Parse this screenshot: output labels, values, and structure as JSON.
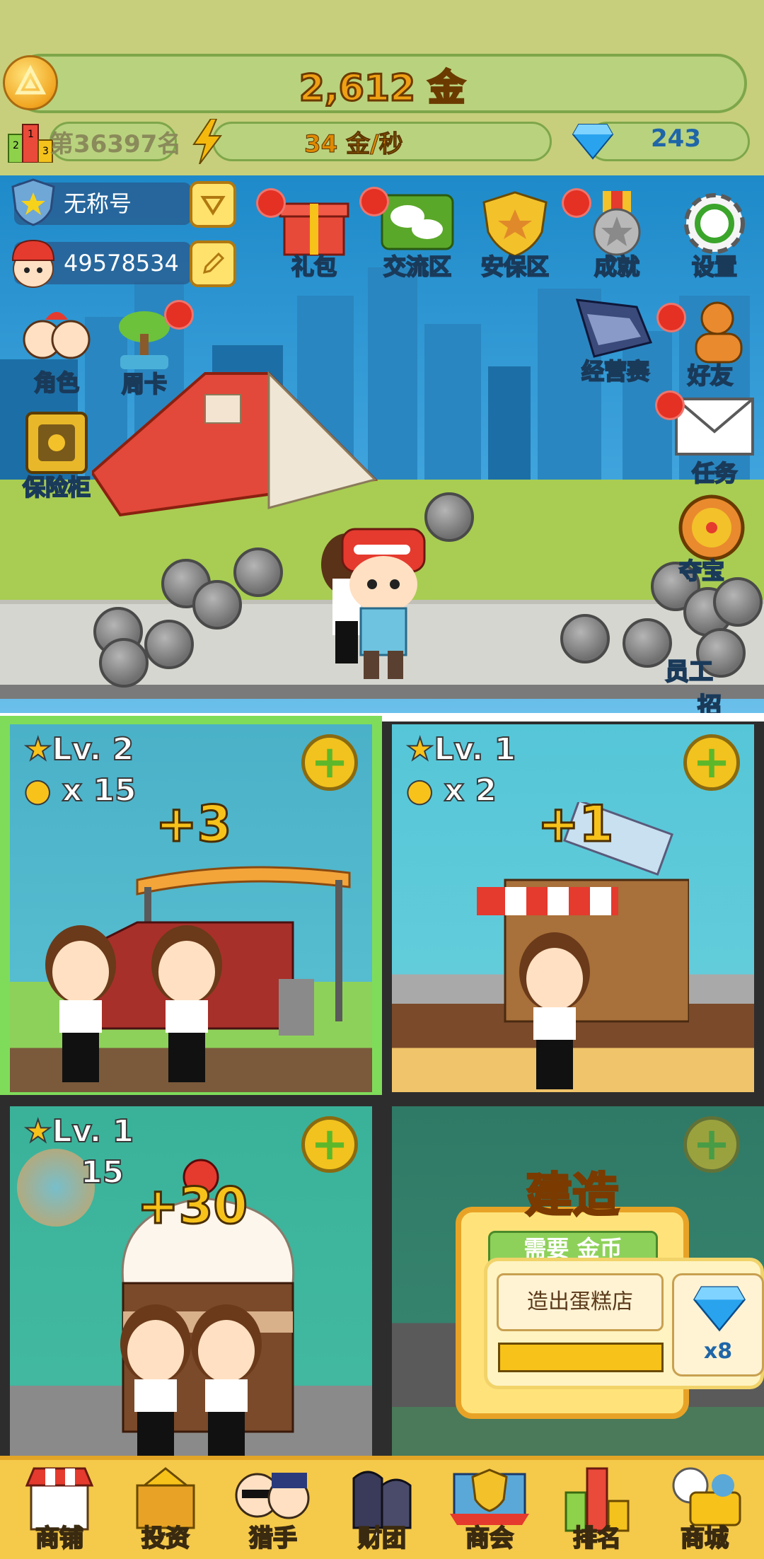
{
  "hud": {
    "gold": "2,612 金",
    "rank": "第36397名",
    "speed": "34 金/秒",
    "diamonds": "243"
  },
  "player": {
    "title": "无称号",
    "id": "49578534"
  },
  "top_menu": [
    {
      "label": "礼包",
      "icon": "gift-icon",
      "badge": true
    },
    {
      "label": "交流区",
      "icon": "chat-icon",
      "badge": true
    },
    {
      "label": "安保区",
      "icon": "shield-icon",
      "badge": false
    },
    {
      "label": "成就",
      "icon": "medal-icon",
      "badge": true
    },
    {
      "label": "设置",
      "icon": "gear-icon",
      "badge": false
    }
  ],
  "left_menu": [
    {
      "label": "角色",
      "icon": "characters-icon"
    },
    {
      "label": "周卡",
      "icon": "bonsai-icon",
      "badge": true
    },
    {
      "label": "保险柜",
      "icon": "safe-icon"
    }
  ],
  "right_menu": [
    {
      "label": "经营赛",
      "icon": "contest-icon"
    },
    {
      "label": "好友",
      "icon": "friends-icon",
      "badge": true
    },
    {
      "label": "任务",
      "icon": "envelope-icon",
      "badge": true
    },
    {
      "label": "夺宝",
      "icon": "wheel-icon"
    },
    {
      "label": "员工",
      "icon": "staff-icon"
    },
    {
      "label": "招",
      "icon": ""
    }
  ],
  "shops": [
    {
      "level": "Lv. 2",
      "staff": "x 15",
      "income": "+3"
    },
    {
      "level": "Lv. 1",
      "staff": "x 2",
      "income": "+1"
    },
    {
      "level": "Lv. 1",
      "staff": "15",
      "income": "+30"
    },
    {
      "build_title": "建造",
      "build_sub": "需要 金币",
      "tooltip": "造出蛋糕店",
      "cost": "x8"
    }
  ],
  "nav": [
    {
      "label": "商铺",
      "icon": "shop-icon"
    },
    {
      "label": "投资",
      "icon": "invest-icon"
    },
    {
      "label": "猎手",
      "icon": "hunter-icon"
    },
    {
      "label": "财团",
      "icon": "consortium-icon"
    },
    {
      "label": "商会",
      "icon": "guild-icon"
    },
    {
      "label": "排名",
      "icon": "ranking-icon"
    },
    {
      "label": "商城",
      "icon": "mall-icon"
    }
  ],
  "colors": {
    "gold_text": "#f0a014",
    "card_selected_border": "#7fdc5a",
    "nav_bg": "#f5c94a",
    "sky": "#3fa3dc"
  }
}
